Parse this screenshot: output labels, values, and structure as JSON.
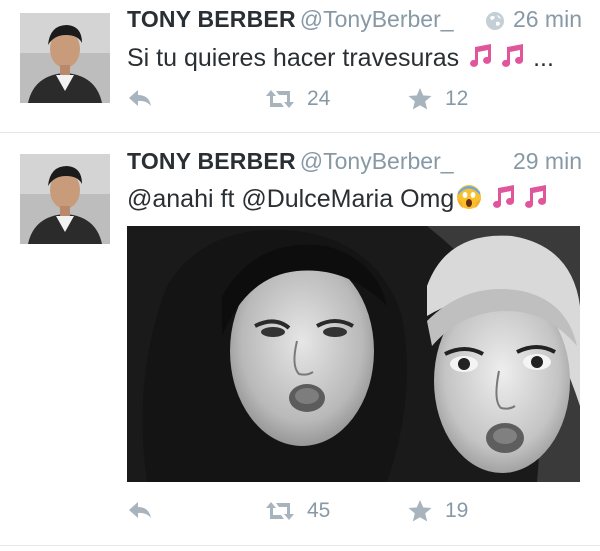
{
  "colors": {
    "text": "#292f33",
    "muted": "#8899a6",
    "divider": "#e1e8ed",
    "music_notes": "#e0569b"
  },
  "tweets": [
    {
      "author_name": "TONY BERBER",
      "handle": "@TonyBerber_",
      "time": "26 min",
      "show_globe_icon": true,
      "text": "Si tu quieres hacer travesuras",
      "text_suffix": "...",
      "retweets": "24",
      "favorites": "12"
    },
    {
      "author_name": "TONY BERBER",
      "handle": "@TonyBerber_",
      "time": "29 min",
      "show_globe_icon": false,
      "text": "@anahi ft @DulceMaria Omg",
      "retweets": "45",
      "favorites": "19",
      "has_photo": true
    }
  ]
}
